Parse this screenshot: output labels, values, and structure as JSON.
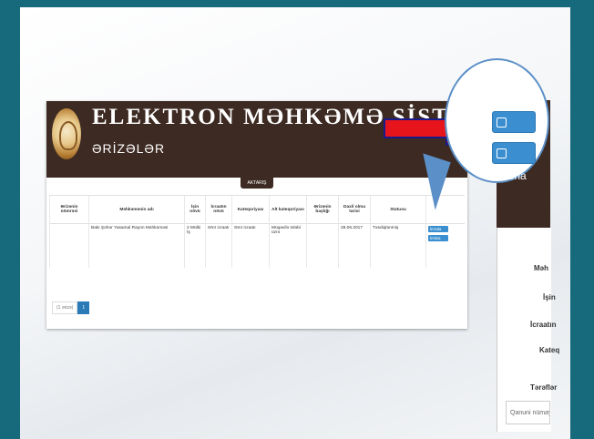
{
  "header": {
    "title": "ELEKTRON MƏHKƏMƏ SİSTEMİ",
    "subtitle": "ƏRİZƏLƏR"
  },
  "export_label": "AKTARIŞ",
  "table": {
    "columns": [
      "Ərizənin nömrəsi",
      "Məhkəmənin adı",
      "İşin növü",
      "İcraatın növü",
      "Kateqoriyası",
      "Alt kateqoriyası",
      "Ərizənin başlığı",
      "Daxil olma tarixi",
      "Statusu",
      ""
    ],
    "rows": [
      {
        "number": "",
        "court": "Bakı Şəhər Yasamal Rayon Məhkəməsi",
        "case_type": "2 Mülki İş",
        "proceeding": "Əmr icraatı",
        "category": "Əmr icraatı",
        "subcategory": "Müqavilə tələbi üzrə",
        "title": "",
        "date": "28.06.2017",
        "status": "Təsdiqlənmiş",
        "sign_label": "İmzala",
        "reject_label": "İmtina"
      }
    ]
  },
  "pager": {
    "prev_label": "(1 ərizə)",
    "current_page": "1"
  },
  "zoom": {
    "sign_label": "İmzala",
    "reject_label": "İmtina"
  },
  "right_panel": {
    "labels": [
      "Məh",
      "İşin",
      "İcraatın",
      "Kateq",
      "Tərəflər"
    ],
    "input_text": "Qanuni nümayə"
  },
  "colors": {
    "header_bg": "#3d2a22",
    "button_blue": "#3b8fd0",
    "arrow_red": "#e8141b",
    "background_teal": "#17697c"
  }
}
